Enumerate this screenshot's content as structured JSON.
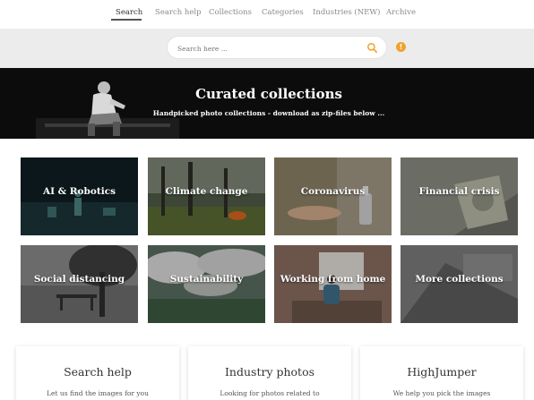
{
  "nav": {
    "items": [
      {
        "label": "Search",
        "active": true
      },
      {
        "label": "Search help"
      },
      {
        "label": "Collections"
      },
      {
        "label": "Categories"
      },
      {
        "label": "Industries (NEW)"
      },
      {
        "label": "Archive"
      }
    ]
  },
  "search": {
    "placeholder": "Search here ...",
    "icon": "search-icon",
    "info_icon": "info-icon",
    "accent": "#f0a32a"
  },
  "hero": {
    "title": "Curated collections",
    "subtitle": "Handpicked photo collections - download as zip-files below ..."
  },
  "collections": [
    {
      "label": "AI & Robotics"
    },
    {
      "label": "Climate change"
    },
    {
      "label": "Coronavirus"
    },
    {
      "label": "Financial crisis"
    },
    {
      "label": "Social distancing"
    },
    {
      "label": "Sustainability"
    },
    {
      "label": "Working from home"
    },
    {
      "label": "More collections"
    }
  ],
  "cards": [
    {
      "title": "Search help",
      "text": "Let us find the images for you"
    },
    {
      "title": "Industry photos",
      "text": "Looking for photos related to"
    },
    {
      "title": "HighJumper",
      "text": "We help you pick the images"
    }
  ]
}
